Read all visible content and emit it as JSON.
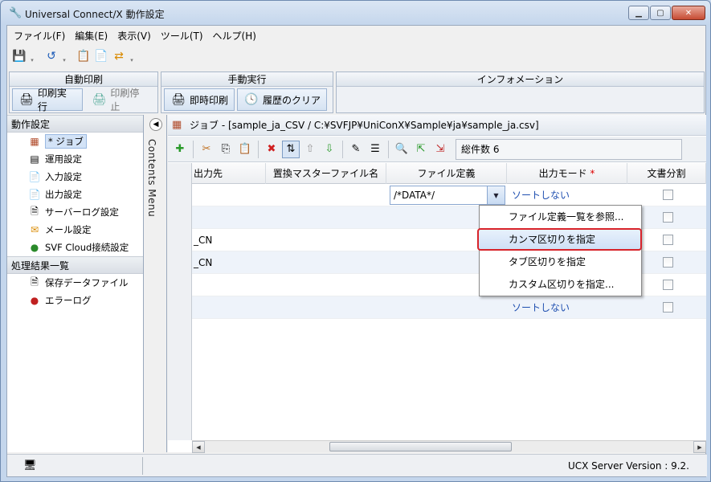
{
  "window": {
    "title": "Universal Connect/X 動作設定",
    "controls": [
      "minimize",
      "maximize",
      "close"
    ]
  },
  "menu": [
    "ファイル(F)",
    "編集(E)",
    "表示(V)",
    "ツール(T)",
    "ヘルプ(H)"
  ],
  "toolbar": {
    "icons": [
      "save-icon",
      "refresh-icon",
      "clipboard-icon",
      "export-icon",
      "import-icon"
    ]
  },
  "band": {
    "auto_print": {
      "title": "自動印刷",
      "start": "印刷実行",
      "stop": "印刷停止"
    },
    "manual": {
      "title": "手動実行",
      "print_now": "即時印刷",
      "clear_history": "履歴のクリア"
    },
    "info": {
      "title": "インフォメーション"
    }
  },
  "left": {
    "section1": "動作設定",
    "items": [
      "* ジョブ",
      "運用設定",
      "入力設定",
      "出力設定",
      "サーバーログ設定",
      "メール設定",
      "SVF Cloud接続設定"
    ],
    "section2": "処理結果一覧",
    "results": [
      "保存データファイル",
      "エラーログ"
    ],
    "contents_menu": "Contents Menu"
  },
  "job": {
    "header": "ジョブ - [sample_ja_CSV / C:¥SVFJP¥UniConX¥Sample¥ja¥sample_ja.csv]",
    "count": "総件数 6"
  },
  "table": {
    "headers": [
      "出力先",
      "置換マスターファイル名",
      "ファイル定義",
      "出力モード",
      "文書分割"
    ],
    "required_mark": "*",
    "rows": [
      {
        "dest": "",
        "def": "/*DATA*/",
        "mode": "ソートしない"
      },
      {
        "dest": "",
        "def": "",
        "mode": ""
      },
      {
        "dest": "_CN",
        "def": "",
        "mode": ""
      },
      {
        "dest": "_CN",
        "def": "",
        "mode": ""
      },
      {
        "dest": "",
        "def": "",
        "mode": ""
      },
      {
        "dest": "",
        "def": "",
        "mode": "ソートしない"
      }
    ]
  },
  "popup": {
    "items": [
      "ファイル定義一覧を参照...",
      "カンマ区切りを指定",
      "タブ区切りを指定",
      "カスタム区切りを指定..."
    ],
    "highlighted_index": 1
  },
  "status": {
    "version": "UCX Server Version : 9.2."
  },
  "colors": {
    "accent": "#1f4fb0",
    "highlight_border": "#d8232a",
    "required": "#d00000"
  }
}
